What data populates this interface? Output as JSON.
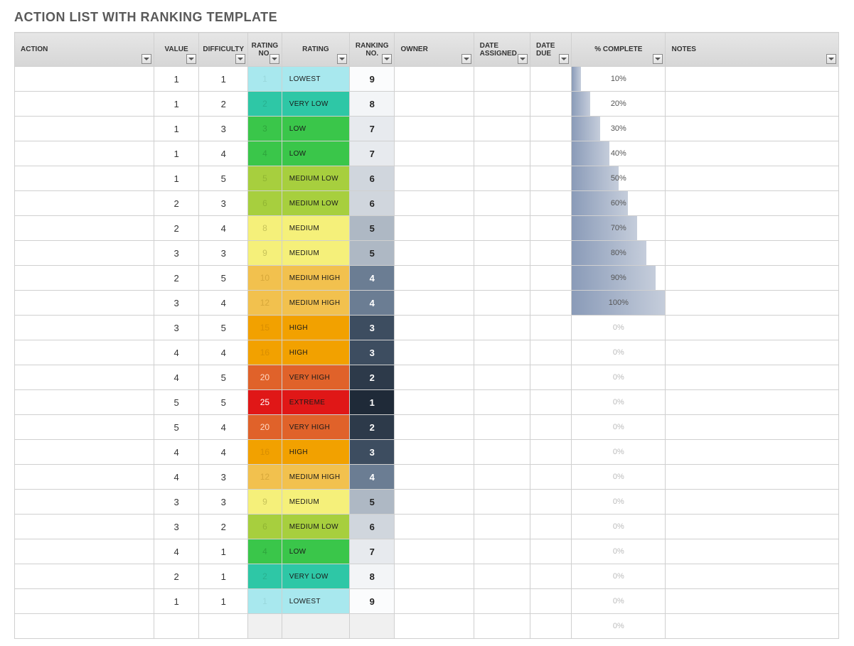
{
  "title": "ACTION LIST WITH RANKING TEMPLATE",
  "columns": [
    {
      "key": "action",
      "label": "ACTION",
      "class": "col-action",
      "align": "left",
      "filter": true
    },
    {
      "key": "value",
      "label": "VALUE",
      "class": "col-value",
      "align": "center",
      "filter": true
    },
    {
      "key": "difficulty",
      "label": "DIFFICULTY",
      "class": "col-diff",
      "align": "center",
      "filter": true
    },
    {
      "key": "rating_no",
      "label": "RATING NO.",
      "class": "col-rno",
      "align": "center",
      "filter": true
    },
    {
      "key": "rating",
      "label": "RATING",
      "class": "col-rating",
      "align": "center",
      "filter": true
    },
    {
      "key": "ranking_no",
      "label": "RANKING NO.",
      "class": "col-rank",
      "align": "center",
      "filter": true
    },
    {
      "key": "owner",
      "label": "OWNER",
      "class": "col-owner",
      "align": "left",
      "filter": true
    },
    {
      "key": "date_assigned",
      "label": "DATE ASSIGNED",
      "class": "col-dassign",
      "align": "left",
      "filter": true
    },
    {
      "key": "date_due",
      "label": "DATE DUE",
      "class": "col-ddue",
      "align": "left",
      "filter": true
    },
    {
      "key": "pct_complete",
      "label": "% COMPLETE",
      "class": "col-pct",
      "align": "center",
      "filter": true
    },
    {
      "key": "notes",
      "label": "NOTES",
      "class": "col-notes",
      "align": "left",
      "filter": true
    }
  ],
  "rating_styles": {
    "LOWEST": {
      "no_bg": "#a8e8ee",
      "no_fg": "#9ad8dc",
      "cell_bg": "#a8e8ee",
      "cell_fg": "#1a1a1a"
    },
    "VERY LOW": {
      "no_bg": "#2ec7a6",
      "no_fg": "#28b08f",
      "cell_bg": "#2ec7a6",
      "cell_fg": "#1a1a1a"
    },
    "LOW": {
      "no_bg": "#3ac64a",
      "no_fg": "#2ea53c",
      "cell_bg": "#3ac64a",
      "cell_fg": "#1a1a1a"
    },
    "MEDIUM LOW": {
      "no_bg": "#a7cf3e",
      "no_fg": "#90b532",
      "cell_bg": "#a7cf3e",
      "cell_fg": "#1a1a1a"
    },
    "MEDIUM": {
      "no_bg": "#f5f07a",
      "no_fg": "#c7c35a",
      "cell_bg": "#f5f07a",
      "cell_fg": "#1a1a1a"
    },
    "MEDIUM HIGH": {
      "no_bg": "#f2c14e",
      "no_fg": "#d7a83a",
      "cell_bg": "#f2c14e",
      "cell_fg": "#1a1a1a"
    },
    "HIGH": {
      "no_bg": "#f2a100",
      "no_fg": "#d98e00",
      "cell_bg": "#f2a100",
      "cell_fg": "#1a1a1a"
    },
    "VERY HIGH": {
      "no_bg": "#e0622a",
      "no_fg": "#ffd7c2",
      "cell_bg": "#e0622a",
      "cell_fg": "#1a1a1a"
    },
    "EXTREME": {
      "no_bg": "#e01717",
      "no_fg": "#ffffff",
      "cell_bg": "#e01717",
      "cell_fg": "#1a1a1a"
    }
  },
  "rank_styles": {
    "1": {
      "bg": "#1f2a38",
      "fg": "#ffffff"
    },
    "2": {
      "bg": "#2d3a4a",
      "fg": "#ffffff"
    },
    "3": {
      "bg": "#3d4d60",
      "fg": "#ffffff"
    },
    "4": {
      "bg": "#6b7d93",
      "fg": "#ffffff"
    },
    "5": {
      "bg": "#aeb8c4",
      "fg": "#222"
    },
    "6": {
      "bg": "#d0d6dd",
      "fg": "#222"
    },
    "7": {
      "bg": "#e7eaee",
      "fg": "#222"
    },
    "8": {
      "bg": "#f3f5f7",
      "fg": "#222"
    },
    "9": {
      "bg": "#fbfcfd",
      "fg": "#222"
    }
  },
  "rows": [
    {
      "value": 1,
      "difficulty": 1,
      "rating_no": 1,
      "rating": "LOWEST",
      "ranking_no": 9,
      "pct": 10
    },
    {
      "value": 1,
      "difficulty": 2,
      "rating_no": 2,
      "rating": "VERY LOW",
      "ranking_no": 8,
      "pct": 20
    },
    {
      "value": 1,
      "difficulty": 3,
      "rating_no": 3,
      "rating": "LOW",
      "ranking_no": 7,
      "pct": 30
    },
    {
      "value": 1,
      "difficulty": 4,
      "rating_no": 4,
      "rating": "LOW",
      "ranking_no": 7,
      "pct": 40
    },
    {
      "value": 1,
      "difficulty": 5,
      "rating_no": 5,
      "rating": "MEDIUM LOW",
      "ranking_no": 6,
      "pct": 50
    },
    {
      "value": 2,
      "difficulty": 3,
      "rating_no": 6,
      "rating": "MEDIUM LOW",
      "ranking_no": 6,
      "pct": 60
    },
    {
      "value": 2,
      "difficulty": 4,
      "rating_no": 8,
      "rating": "MEDIUM",
      "ranking_no": 5,
      "pct": 70
    },
    {
      "value": 3,
      "difficulty": 3,
      "rating_no": 9,
      "rating": "MEDIUM",
      "ranking_no": 5,
      "pct": 80
    },
    {
      "value": 2,
      "difficulty": 5,
      "rating_no": 10,
      "rating": "MEDIUM HIGH",
      "ranking_no": 4,
      "pct": 90
    },
    {
      "value": 3,
      "difficulty": 4,
      "rating_no": 12,
      "rating": "MEDIUM HIGH",
      "ranking_no": 4,
      "pct": 100
    },
    {
      "value": 3,
      "difficulty": 5,
      "rating_no": 15,
      "rating": "HIGH",
      "ranking_no": 3,
      "pct": 0
    },
    {
      "value": 4,
      "difficulty": 4,
      "rating_no": 16,
      "rating": "HIGH",
      "ranking_no": 3,
      "pct": 0
    },
    {
      "value": 4,
      "difficulty": 5,
      "rating_no": 20,
      "rating": "VERY HIGH",
      "ranking_no": 2,
      "pct": 0
    },
    {
      "value": 5,
      "difficulty": 5,
      "rating_no": 25,
      "rating": "EXTREME",
      "ranking_no": 1,
      "pct": 0
    },
    {
      "value": 5,
      "difficulty": 4,
      "rating_no": 20,
      "rating": "VERY HIGH",
      "ranking_no": 2,
      "pct": 0
    },
    {
      "value": 4,
      "difficulty": 4,
      "rating_no": 16,
      "rating": "HIGH",
      "ranking_no": 3,
      "pct": 0
    },
    {
      "value": 4,
      "difficulty": 3,
      "rating_no": 12,
      "rating": "MEDIUM HIGH",
      "ranking_no": 4,
      "pct": 0
    },
    {
      "value": 3,
      "difficulty": 3,
      "rating_no": 9,
      "rating": "MEDIUM",
      "ranking_no": 5,
      "pct": 0
    },
    {
      "value": 3,
      "difficulty": 2,
      "rating_no": 6,
      "rating": "MEDIUM LOW",
      "ranking_no": 6,
      "pct": 0
    },
    {
      "value": 4,
      "difficulty": 1,
      "rating_no": 4,
      "rating": "LOW",
      "ranking_no": 7,
      "pct": 0
    },
    {
      "value": 2,
      "difficulty": 1,
      "rating_no": 2,
      "rating": "VERY LOW",
      "ranking_no": 8,
      "pct": 0
    },
    {
      "value": 1,
      "difficulty": 1,
      "rating_no": 1,
      "rating": "LOWEST",
      "ranking_no": 9,
      "pct": 0
    },
    {
      "empty": true,
      "pct": 0
    }
  ]
}
